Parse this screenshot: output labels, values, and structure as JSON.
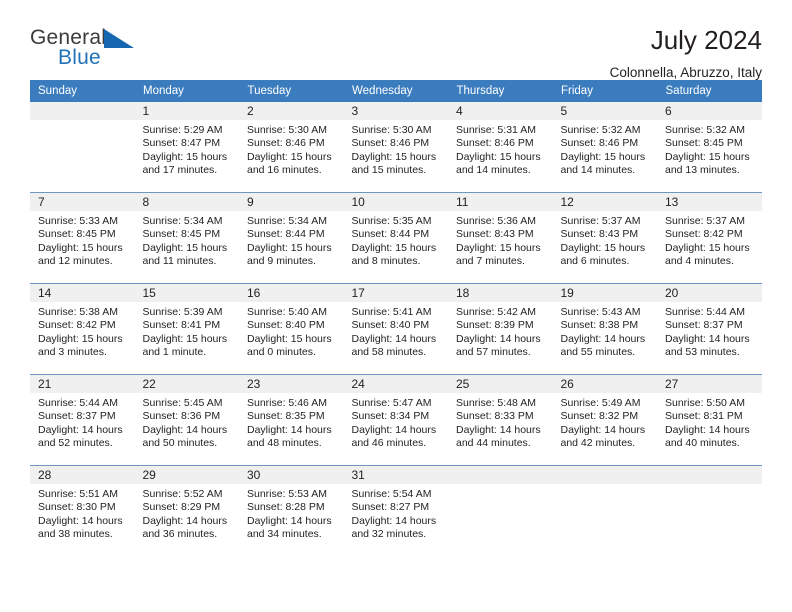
{
  "brand": {
    "name_top": "General",
    "name_bottom": "Blue",
    "triangle_color": "#1667b1",
    "text_color": "#3b3b3b",
    "accent_color": "#2272b8"
  },
  "header": {
    "title": "July 2024",
    "subtitle": "Colonnella, Abruzzo, Italy"
  },
  "calendar": {
    "header_bg": "#3a7cbe",
    "header_text": "#ffffff",
    "daynum_bg": "#f0f0f0",
    "grid_line": "#6f97bf",
    "weekday_headers": [
      "Sunday",
      "Monday",
      "Tuesday",
      "Wednesday",
      "Thursday",
      "Friday",
      "Saturday"
    ],
    "labels": {
      "sunrise": "Sunrise:",
      "sunset": "Sunset:",
      "daylight": "Daylight:"
    },
    "weeks": [
      [
        {
          "day": "",
          "sunrise": "",
          "sunset": "",
          "daylight_1": "",
          "daylight_2": ""
        },
        {
          "day": "1",
          "sunrise": "Sunrise: 5:29 AM",
          "sunset": "Sunset: 8:47 PM",
          "daylight_1": "Daylight: 15 hours",
          "daylight_2": "and 17 minutes."
        },
        {
          "day": "2",
          "sunrise": "Sunrise: 5:30 AM",
          "sunset": "Sunset: 8:46 PM",
          "daylight_1": "Daylight: 15 hours",
          "daylight_2": "and 16 minutes."
        },
        {
          "day": "3",
          "sunrise": "Sunrise: 5:30 AM",
          "sunset": "Sunset: 8:46 PM",
          "daylight_1": "Daylight: 15 hours",
          "daylight_2": "and 15 minutes."
        },
        {
          "day": "4",
          "sunrise": "Sunrise: 5:31 AM",
          "sunset": "Sunset: 8:46 PM",
          "daylight_1": "Daylight: 15 hours",
          "daylight_2": "and 14 minutes."
        },
        {
          "day": "5",
          "sunrise": "Sunrise: 5:32 AM",
          "sunset": "Sunset: 8:46 PM",
          "daylight_1": "Daylight: 15 hours",
          "daylight_2": "and 14 minutes."
        },
        {
          "day": "6",
          "sunrise": "Sunrise: 5:32 AM",
          "sunset": "Sunset: 8:45 PM",
          "daylight_1": "Daylight: 15 hours",
          "daylight_2": "and 13 minutes."
        }
      ],
      [
        {
          "day": "7",
          "sunrise": "Sunrise: 5:33 AM",
          "sunset": "Sunset: 8:45 PM",
          "daylight_1": "Daylight: 15 hours",
          "daylight_2": "and 12 minutes."
        },
        {
          "day": "8",
          "sunrise": "Sunrise: 5:34 AM",
          "sunset": "Sunset: 8:45 PM",
          "daylight_1": "Daylight: 15 hours",
          "daylight_2": "and 11 minutes."
        },
        {
          "day": "9",
          "sunrise": "Sunrise: 5:34 AM",
          "sunset": "Sunset: 8:44 PM",
          "daylight_1": "Daylight: 15 hours",
          "daylight_2": "and 9 minutes."
        },
        {
          "day": "10",
          "sunrise": "Sunrise: 5:35 AM",
          "sunset": "Sunset: 8:44 PM",
          "daylight_1": "Daylight: 15 hours",
          "daylight_2": "and 8 minutes."
        },
        {
          "day": "11",
          "sunrise": "Sunrise: 5:36 AM",
          "sunset": "Sunset: 8:43 PM",
          "daylight_1": "Daylight: 15 hours",
          "daylight_2": "and 7 minutes."
        },
        {
          "day": "12",
          "sunrise": "Sunrise: 5:37 AM",
          "sunset": "Sunset: 8:43 PM",
          "daylight_1": "Daylight: 15 hours",
          "daylight_2": "and 6 minutes."
        },
        {
          "day": "13",
          "sunrise": "Sunrise: 5:37 AM",
          "sunset": "Sunset: 8:42 PM",
          "daylight_1": "Daylight: 15 hours",
          "daylight_2": "and 4 minutes."
        }
      ],
      [
        {
          "day": "14",
          "sunrise": "Sunrise: 5:38 AM",
          "sunset": "Sunset: 8:42 PM",
          "daylight_1": "Daylight: 15 hours",
          "daylight_2": "and 3 minutes."
        },
        {
          "day": "15",
          "sunrise": "Sunrise: 5:39 AM",
          "sunset": "Sunset: 8:41 PM",
          "daylight_1": "Daylight: 15 hours",
          "daylight_2": "and 1 minute."
        },
        {
          "day": "16",
          "sunrise": "Sunrise: 5:40 AM",
          "sunset": "Sunset: 8:40 PM",
          "daylight_1": "Daylight: 15 hours",
          "daylight_2": "and 0 minutes."
        },
        {
          "day": "17",
          "sunrise": "Sunrise: 5:41 AM",
          "sunset": "Sunset: 8:40 PM",
          "daylight_1": "Daylight: 14 hours",
          "daylight_2": "and 58 minutes."
        },
        {
          "day": "18",
          "sunrise": "Sunrise: 5:42 AM",
          "sunset": "Sunset: 8:39 PM",
          "daylight_1": "Daylight: 14 hours",
          "daylight_2": "and 57 minutes."
        },
        {
          "day": "19",
          "sunrise": "Sunrise: 5:43 AM",
          "sunset": "Sunset: 8:38 PM",
          "daylight_1": "Daylight: 14 hours",
          "daylight_2": "and 55 minutes."
        },
        {
          "day": "20",
          "sunrise": "Sunrise: 5:44 AM",
          "sunset": "Sunset: 8:37 PM",
          "daylight_1": "Daylight: 14 hours",
          "daylight_2": "and 53 minutes."
        }
      ],
      [
        {
          "day": "21",
          "sunrise": "Sunrise: 5:44 AM",
          "sunset": "Sunset: 8:37 PM",
          "daylight_1": "Daylight: 14 hours",
          "daylight_2": "and 52 minutes."
        },
        {
          "day": "22",
          "sunrise": "Sunrise: 5:45 AM",
          "sunset": "Sunset: 8:36 PM",
          "daylight_1": "Daylight: 14 hours",
          "daylight_2": "and 50 minutes."
        },
        {
          "day": "23",
          "sunrise": "Sunrise: 5:46 AM",
          "sunset": "Sunset: 8:35 PM",
          "daylight_1": "Daylight: 14 hours",
          "daylight_2": "and 48 minutes."
        },
        {
          "day": "24",
          "sunrise": "Sunrise: 5:47 AM",
          "sunset": "Sunset: 8:34 PM",
          "daylight_1": "Daylight: 14 hours",
          "daylight_2": "and 46 minutes."
        },
        {
          "day": "25",
          "sunrise": "Sunrise: 5:48 AM",
          "sunset": "Sunset: 8:33 PM",
          "daylight_1": "Daylight: 14 hours",
          "daylight_2": "and 44 minutes."
        },
        {
          "day": "26",
          "sunrise": "Sunrise: 5:49 AM",
          "sunset": "Sunset: 8:32 PM",
          "daylight_1": "Daylight: 14 hours",
          "daylight_2": "and 42 minutes."
        },
        {
          "day": "27",
          "sunrise": "Sunrise: 5:50 AM",
          "sunset": "Sunset: 8:31 PM",
          "daylight_1": "Daylight: 14 hours",
          "daylight_2": "and 40 minutes."
        }
      ],
      [
        {
          "day": "28",
          "sunrise": "Sunrise: 5:51 AM",
          "sunset": "Sunset: 8:30 PM",
          "daylight_1": "Daylight: 14 hours",
          "daylight_2": "and 38 minutes."
        },
        {
          "day": "29",
          "sunrise": "Sunrise: 5:52 AM",
          "sunset": "Sunset: 8:29 PM",
          "daylight_1": "Daylight: 14 hours",
          "daylight_2": "and 36 minutes."
        },
        {
          "day": "30",
          "sunrise": "Sunrise: 5:53 AM",
          "sunset": "Sunset: 8:28 PM",
          "daylight_1": "Daylight: 14 hours",
          "daylight_2": "and 34 minutes."
        },
        {
          "day": "31",
          "sunrise": "Sunrise: 5:54 AM",
          "sunset": "Sunset: 8:27 PM",
          "daylight_1": "Daylight: 14 hours",
          "daylight_2": "and 32 minutes."
        },
        {
          "day": "",
          "sunrise": "",
          "sunset": "",
          "daylight_1": "",
          "daylight_2": ""
        },
        {
          "day": "",
          "sunrise": "",
          "sunset": "",
          "daylight_1": "",
          "daylight_2": ""
        },
        {
          "day": "",
          "sunrise": "",
          "sunset": "",
          "daylight_1": "",
          "daylight_2": ""
        }
      ]
    ]
  }
}
